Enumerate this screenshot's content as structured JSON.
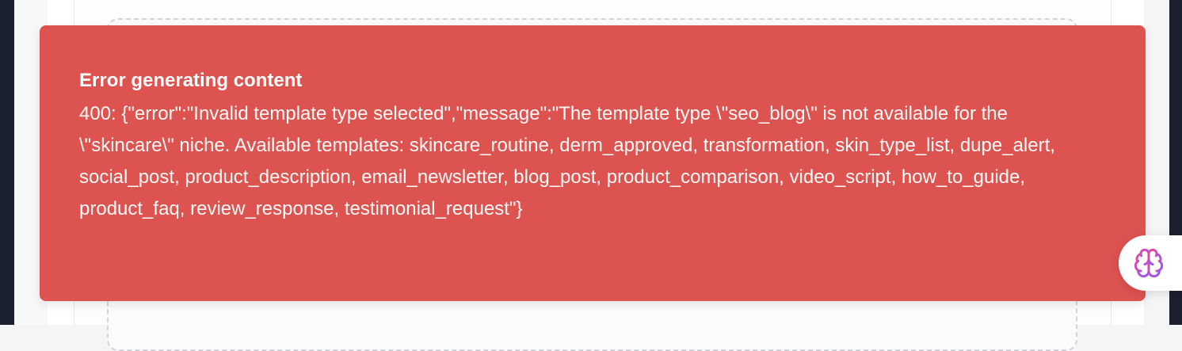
{
  "toast": {
    "title": "Error generating content",
    "message": "400: {\"error\":\"Invalid template type selected\",\"message\":\"The template type \\\"seo_blog\\\" is not available for the \\\"skincare\\\" niche. Available templates: skincare_routine, derm_approved, transformation, skin_type_list, dupe_alert, social_post, product_description, email_newsletter, blog_post, product_comparison, video_script, how_to_guide, product_faq, review_response, testimonial_request\"}",
    "background_color": "#dd5350",
    "text_color": "#ffffff"
  },
  "assistant_button": {
    "icon": "brain-icon",
    "icon_colors": [
      "#ec4899",
      "#8b5cf6"
    ]
  }
}
